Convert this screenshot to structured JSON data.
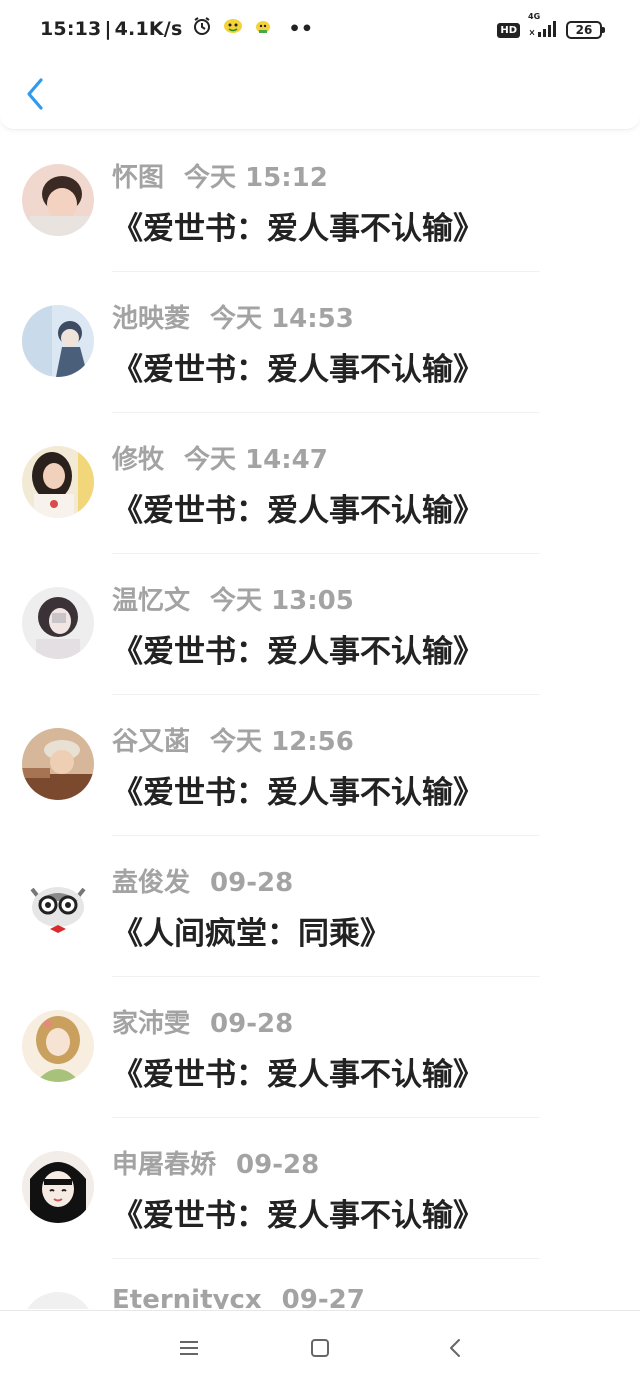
{
  "status_bar": {
    "time": "15:13",
    "separator": "|",
    "net_speed": "4.1K/s",
    "more": "••",
    "hd_label": "HD",
    "network_label": "4G",
    "battery": "26"
  },
  "header": {
    "back_icon": "chevron-left-icon",
    "accent_color": "#2f9bf0"
  },
  "entries": [
    {
      "name": "怀图",
      "time": "今天 15:12",
      "title": "《爱世书：爱人事不认输》",
      "avatar_colors": [
        "#f1d8cf",
        "#7a5548"
      ]
    },
    {
      "name": "池映菱",
      "time": "今天 14:53",
      "title": "《爱世书：爱人事不认输》",
      "avatar_colors": [
        "#dbe7f2",
        "#4a5f7a"
      ]
    },
    {
      "name": "修牧",
      "time": "今天 14:47",
      "title": "《爱世书：爱人事不认输》",
      "avatar_colors": [
        "#f3ead6",
        "#2a201c"
      ]
    },
    {
      "name": "温忆文",
      "time": "今天 13:05",
      "title": "《爱世书：爱人事不认输》",
      "avatar_colors": [
        "#eeeeef",
        "#3a3236"
      ]
    },
    {
      "name": "谷又菡",
      "time": "今天 12:56",
      "title": "《爱世书：爱人事不认输》",
      "avatar_colors": [
        "#d7b79a",
        "#7b4a2e"
      ]
    },
    {
      "name": "盍俊发",
      "time": "09-28",
      "title": "《人间疯堂：同乘》",
      "avatar_colors": [
        "#ffffff",
        "#555555"
      ]
    },
    {
      "name": "家沛雯",
      "time": "09-28",
      "title": "《爱世书：爱人事不认输》",
      "avatar_colors": [
        "#f7eee0",
        "#c9a05d"
      ]
    },
    {
      "name": "申屠春娇",
      "time": "09-28",
      "title": "《爱世书：爱人事不认输》",
      "avatar_colors": [
        "#f2ede8",
        "#111111"
      ]
    },
    {
      "name": "Eternitycx",
      "time": "09-27",
      "title": "",
      "avatar_colors": [
        "#f0f0f0",
        "#222222"
      ]
    }
  ],
  "nav_bar": {
    "menu_icon": "menu-icon",
    "home_icon": "home-square-icon",
    "back_icon": "triangle-back-icon"
  }
}
